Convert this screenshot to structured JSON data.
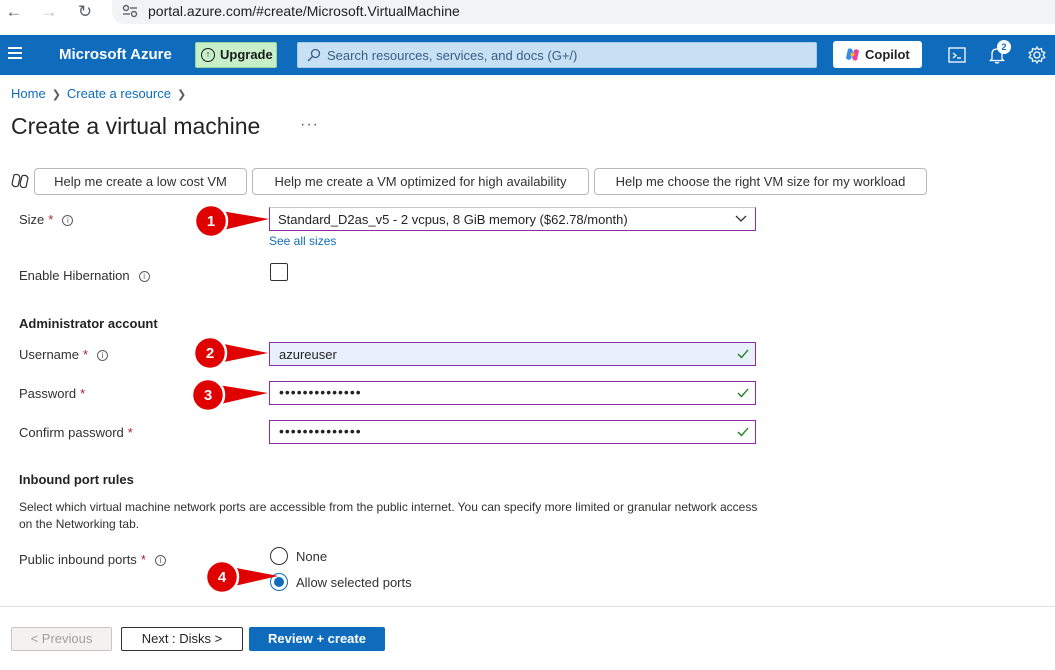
{
  "browser": {
    "url": "portal.azure.com/#create/Microsoft.VirtualMachine"
  },
  "topbar": {
    "brand": "Microsoft Azure",
    "upgrade_label": "Upgrade",
    "search_placeholder": "Search resources, services, and docs (G+/)",
    "copilot_label": "Copilot",
    "notification_count": "2",
    "accent_color": "#0f6cbd"
  },
  "breadcrumb": [
    "Home",
    "Create a resource"
  ],
  "page": {
    "title": "Create a virtual machine",
    "more": "···"
  },
  "help_buttons": [
    "Help me create a low cost VM",
    "Help me create a VM optimized for high availability",
    "Help me choose the right VM size for my workload"
  ],
  "form": {
    "size": {
      "label": "Size",
      "required": "*",
      "value": "Standard_D2as_v5 - 2 vcpus, 8 GiB memory ($62.78/month)",
      "link": "See all sizes"
    },
    "hibernation": {
      "label": "Enable Hibernation",
      "checked": false
    },
    "admin_section": "Administrator account",
    "username": {
      "label": "Username",
      "required": "*",
      "value": "azureuser"
    },
    "password": {
      "label": "Password",
      "required": "*",
      "value": "••••••••••••••"
    },
    "confirm_password": {
      "label": "Confirm password",
      "required": "*",
      "value": "••••••••••••••"
    },
    "inbound_section": "Inbound port rules",
    "inbound_desc": "Select which virtual machine network ports are accessible from the public internet. You can specify more limited or granular network access on the Networking tab.",
    "public_ports": {
      "label": "Public inbound ports",
      "required": "*",
      "options": [
        "None",
        "Allow selected ports"
      ],
      "selected": "Allow selected ports"
    }
  },
  "callouts": [
    "1",
    "2",
    "3",
    "4"
  ],
  "footer": {
    "previous": "< Previous",
    "next": "Next : Disks >",
    "review": "Review + create"
  }
}
